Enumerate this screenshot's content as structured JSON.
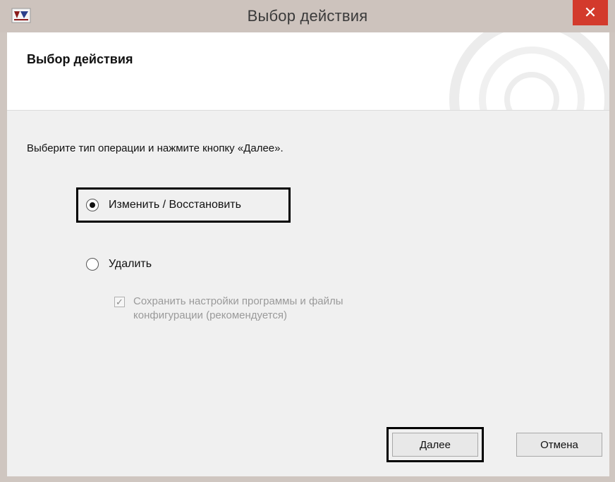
{
  "window": {
    "title": "Выбор действия",
    "close_symbol": "✕"
  },
  "header": {
    "title": "Выбор действия"
  },
  "body": {
    "instruction": "Выберите тип операции и нажмите кнопку «Далее».",
    "options": [
      {
        "label": "Изменить / Восстановить",
        "selected": true
      },
      {
        "label": "Удалить",
        "selected": false
      }
    ],
    "keep_settings": {
      "line1": "Сохранить настройки программы и файлы",
      "line2": "конфигурации (рекомендуется)",
      "checked": true,
      "enabled": false
    }
  },
  "buttons": {
    "next": "Далее",
    "cancel": "Отмена"
  },
  "colors": {
    "close_button": "#d33a2c",
    "titlebar": "#cdc3bd",
    "panel": "#f0f0f0"
  }
}
